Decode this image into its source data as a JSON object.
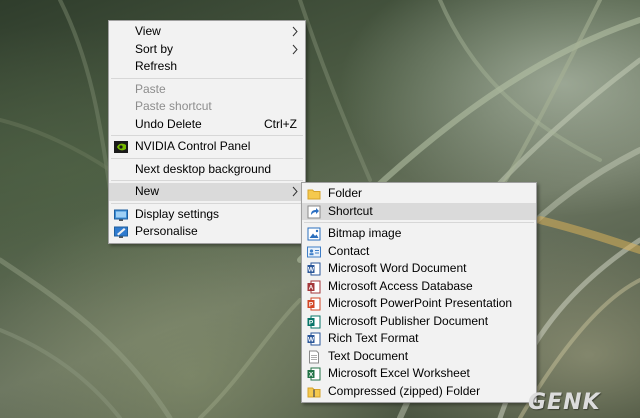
{
  "context_menu": {
    "items": [
      {
        "label": "View",
        "has_submenu": true
      },
      {
        "label": "Sort by",
        "has_submenu": true
      },
      {
        "label": "Refresh"
      },
      {
        "label": "Paste",
        "disabled": true
      },
      {
        "label": "Paste shortcut",
        "disabled": true
      },
      {
        "label": "Undo Delete",
        "shortcut": "Ctrl+Z"
      },
      {
        "label": "NVIDIA Control Panel",
        "icon": "nvidia-icon"
      },
      {
        "label": "Next desktop background"
      },
      {
        "label": "New",
        "has_submenu": true,
        "highlighted": true
      },
      {
        "label": "Display settings",
        "icon": "display-icon"
      },
      {
        "label": "Personalise",
        "icon": "personalise-icon"
      }
    ]
  },
  "new_submenu": {
    "items": [
      {
        "label": "Folder",
        "icon": "folder-icon"
      },
      {
        "label": "Shortcut",
        "icon": "shortcut-icon",
        "highlighted": true
      },
      {
        "label": "Bitmap image",
        "icon": "bitmap-icon"
      },
      {
        "label": "Contact",
        "icon": "contact-icon"
      },
      {
        "label": "Microsoft Word Document",
        "icon": "word-icon"
      },
      {
        "label": "Microsoft Access Database",
        "icon": "access-icon"
      },
      {
        "label": "Microsoft PowerPoint Presentation",
        "icon": "powerpoint-icon"
      },
      {
        "label": "Microsoft Publisher Document",
        "icon": "publisher-icon"
      },
      {
        "label": "Rich Text Format",
        "icon": "rtf-icon"
      },
      {
        "label": "Text Document",
        "icon": "text-icon"
      },
      {
        "label": "Microsoft Excel Worksheet",
        "icon": "excel-icon"
      },
      {
        "label": "Compressed (zipped) Folder",
        "icon": "zip-icon"
      }
    ]
  },
  "watermark": "GENK",
  "colors": {
    "menu_bg": "#f2f2f2",
    "highlight": "#dadada",
    "disabled_text": "#8d8d8d"
  }
}
